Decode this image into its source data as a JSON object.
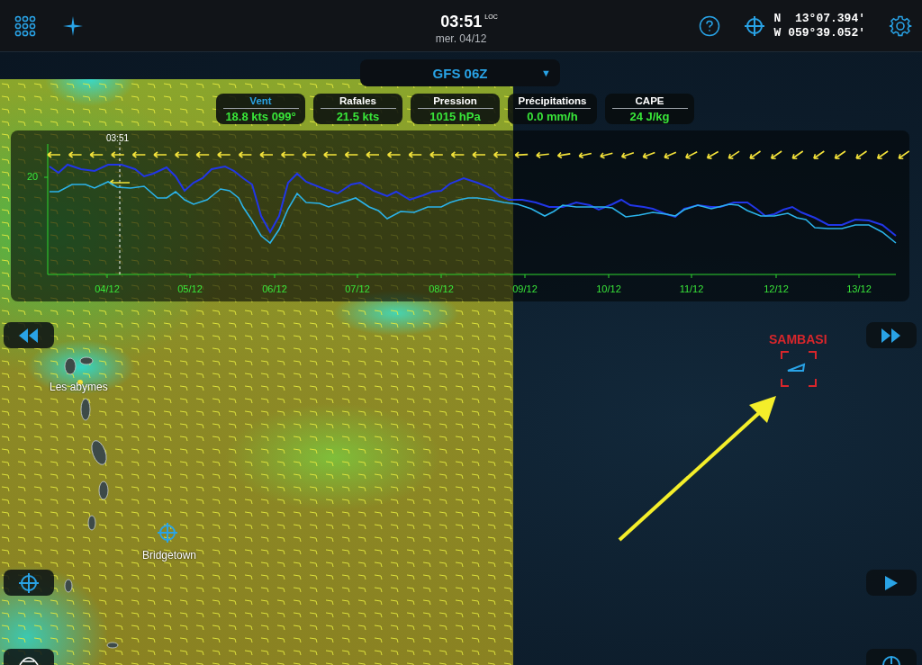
{
  "top_bar": {
    "time": "03:51",
    "time_zone": "LOC",
    "date": "mer. 04/12",
    "position": {
      "lat_hemisphere": "N",
      "lat": "13°07.394'",
      "lon_hemisphere": "W",
      "lon": "059°39.052'"
    }
  },
  "model_selector": {
    "value": "GFS 06Z",
    "symbol": "▼"
  },
  "tabs": [
    {
      "label": "Vent",
      "value": "18.8 kts 099°",
      "selected": true
    },
    {
      "label": "Rafales",
      "value": "21.5 kts",
      "selected": false
    },
    {
      "label": "Pression",
      "value": "1015 hPa",
      "selected": false
    },
    {
      "label": "Précipitations",
      "value": "0.0 mm/h",
      "selected": false
    },
    {
      "label": "CAPE",
      "value": "24 J/kg",
      "selected": false
    }
  ],
  "chart": {
    "cursor_time": "03:51",
    "y_tick": "20",
    "x_labels": [
      "04/12",
      "05/12",
      "06/12",
      "07/12",
      "08/12",
      "09/12",
      "10/12",
      "11/12",
      "12/12",
      "13/12"
    ]
  },
  "map": {
    "place_labels": [
      "Les abymes",
      "Bridgetown"
    ],
    "target": {
      "name": "SAMBASI"
    }
  }
}
